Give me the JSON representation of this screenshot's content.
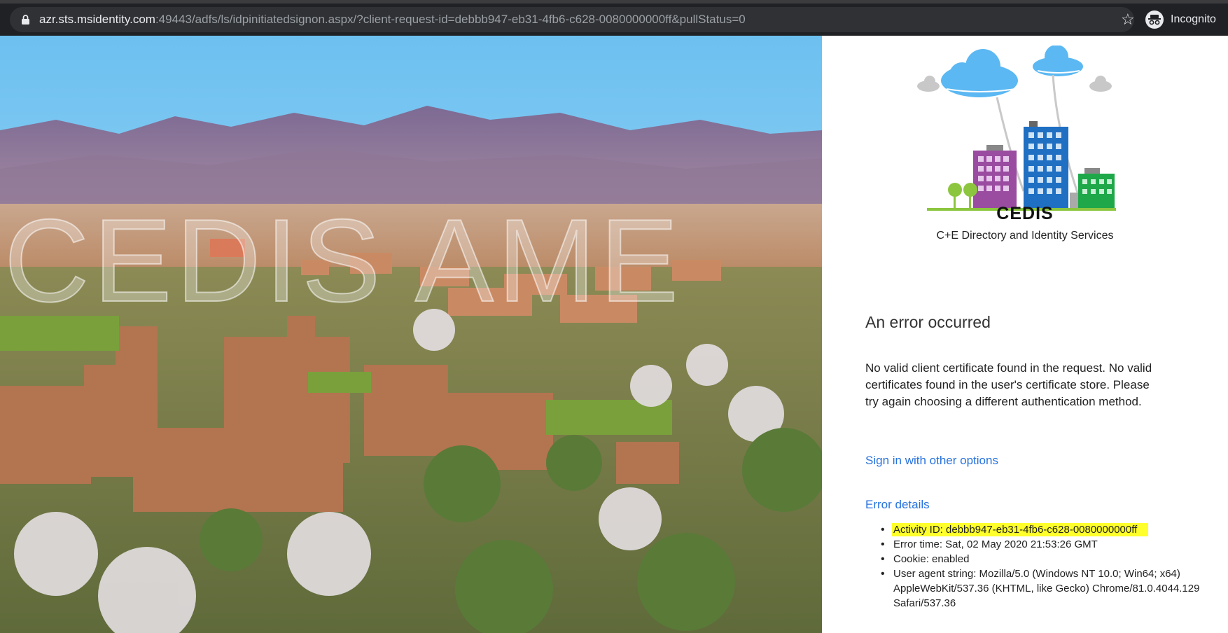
{
  "browser": {
    "url_host": "azr.sts.msidentity.com",
    "url_rest": ":49443/adfs/ls/idpinitiatedsignon.aspx/?client-request-id=debbb947-eb31-4fb6-c628-0080000000ff&pullStatus=0",
    "incognito_label": "Incognito",
    "icons": {
      "lock": "lock-icon",
      "star": "bookmark-star-icon",
      "incognito": "incognito-icon"
    },
    "colors": {
      "toolbar": "#202124",
      "omnibox": "#303134"
    }
  },
  "hero": {
    "watermark": "CEDIS AME"
  },
  "logo": {
    "title": "CEDIS",
    "subtitle": "C+E Directory and Identity Services",
    "colors": {
      "cloud": "#5bb8f2",
      "purple": "#9a4ca0",
      "blue": "#1f6fc2",
      "green": "#1fa84a",
      "tree": "#8cc63f"
    }
  },
  "error": {
    "title": "An error occurred",
    "message": "No valid client certificate found in the request. No valid certificates found in the user's certificate store. Please try again choosing a different authentication method.",
    "sign_in_link": "Sign in with other options",
    "details_link": "Error details",
    "details": [
      "Activity ID: debbb947-eb31-4fb6-c628-0080000000ff",
      "Error time: Sat, 02 May 2020 21:53:26 GMT",
      "Cookie: enabled",
      "User agent string: Mozilla/5.0 (Windows NT 10.0; Win64; x64) AppleWebKit/537.36 (KHTML, like Gecko) Chrome/81.0.4044.129 Safari/537.36"
    ],
    "colors": {
      "link": "#2672de",
      "highlight": "#ffff2b"
    }
  }
}
